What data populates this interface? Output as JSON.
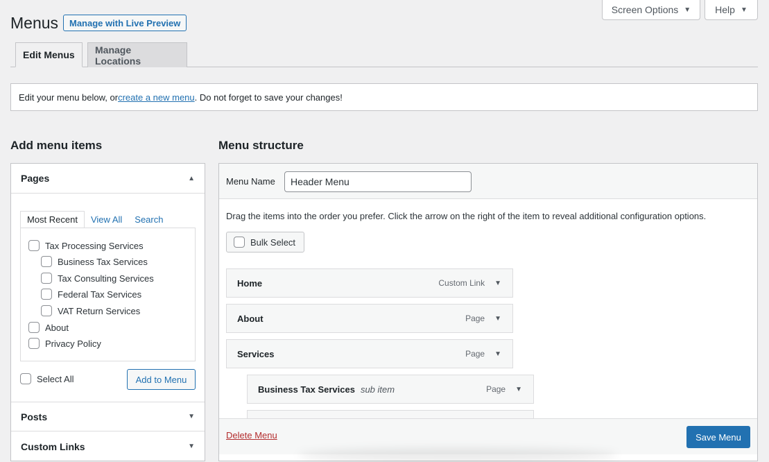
{
  "screen_meta": {
    "screen_options": "Screen Options",
    "help": "Help"
  },
  "header": {
    "title": "Menus",
    "live_preview": "Manage with Live Preview"
  },
  "tabs": [
    {
      "label": "Edit Menus",
      "active": true
    },
    {
      "label": "Manage Locations",
      "active": false
    }
  ],
  "notice": {
    "prefix": "Edit your menu below, or ",
    "link": "create a new menu",
    "suffix": ". Do not forget to save your changes!"
  },
  "add_items": {
    "heading": "Add menu items",
    "pages": {
      "title": "Pages",
      "tabs": [
        "Most Recent",
        "View All",
        "Search"
      ],
      "items": [
        {
          "label": "Tax Processing Services",
          "level": 0
        },
        {
          "label": "Business Tax Services",
          "level": 1
        },
        {
          "label": "Tax Consulting Services",
          "level": 1
        },
        {
          "label": "Federal Tax Services",
          "level": 1
        },
        {
          "label": "VAT Return Services",
          "level": 1
        },
        {
          "label": "About",
          "level": 0
        },
        {
          "label": "Privacy Policy",
          "level": 0
        }
      ],
      "select_all": "Select All",
      "add_button": "Add to Menu"
    },
    "posts": "Posts",
    "custom_links": "Custom Links"
  },
  "structure": {
    "heading": "Menu structure",
    "menu_name_label": "Menu Name",
    "menu_name_value": "Header Menu",
    "instructions": "Drag the items into the order you prefer. Click the arrow on the right of the item to reveal additional configuration options.",
    "bulk_select": "Bulk Select",
    "items": [
      {
        "title": "Home",
        "type": "Custom Link",
        "sub": ""
      },
      {
        "title": "About",
        "type": "Page",
        "sub": ""
      },
      {
        "title": "Services",
        "type": "Page",
        "sub": ""
      },
      {
        "title": "Business Tax Services",
        "type": "Page",
        "sub": "sub item"
      }
    ],
    "delete": "Delete Menu",
    "save": "Save Menu"
  }
}
